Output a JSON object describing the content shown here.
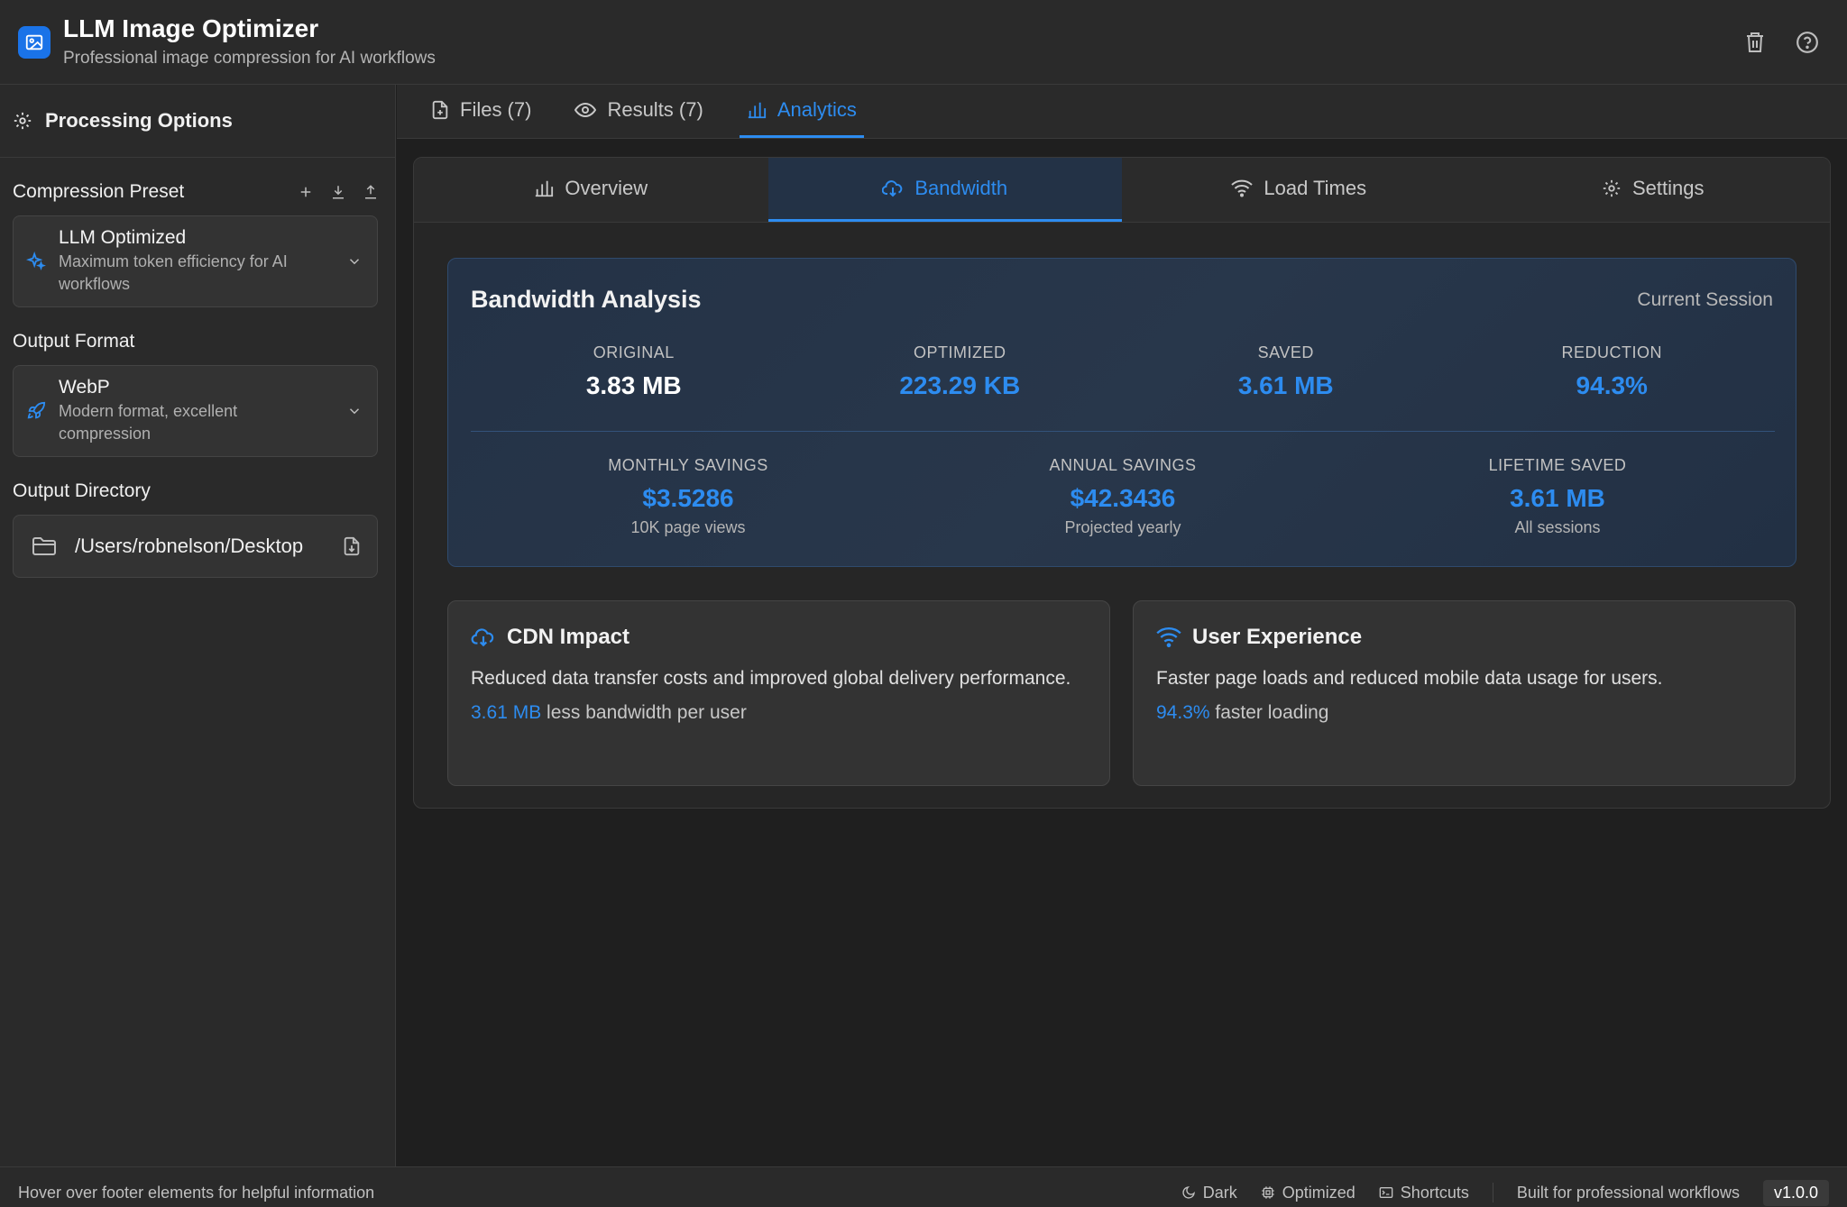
{
  "app": {
    "title": "LLM Image Optimizer",
    "subtitle": "Professional image compression for AI workflows",
    "logo_icon": "image-icon",
    "accent_color": "#2d8cf0"
  },
  "header": {
    "actions": [
      {
        "icon": "trash-icon"
      },
      {
        "icon": "help-circle-icon"
      }
    ]
  },
  "sidebar": {
    "title": "Processing Options",
    "compression_preset": {
      "label": "Compression Preset",
      "selected_title": "LLM Optimized",
      "selected_desc": "Maximum token efficiency for AI workflows",
      "actions": [
        "plus-icon",
        "download-icon",
        "upload-icon"
      ]
    },
    "output_format": {
      "label": "Output Format",
      "selected_title": "WebP",
      "selected_desc": "Modern format, excellent compression"
    },
    "output_directory": {
      "label": "Output Directory",
      "path": "/Users/robnelson/Desktop"
    }
  },
  "tabs": [
    {
      "label": "Files (7)",
      "icon": "file-icon",
      "active": false
    },
    {
      "label": "Results (7)",
      "icon": "eye-icon",
      "active": false
    },
    {
      "label": "Analytics",
      "icon": "bar-chart-icon",
      "active": true
    }
  ],
  "sub_tabs": [
    {
      "label": "Overview",
      "icon": "bar-chart-icon",
      "active": false
    },
    {
      "label": "Bandwidth",
      "icon": "cloud-download-icon",
      "active": true
    },
    {
      "label": "Load Times",
      "icon": "wifi-icon",
      "active": false
    },
    {
      "label": "Settings",
      "icon": "gear-icon",
      "active": false
    }
  ],
  "bandwidth": {
    "title": "Bandwidth Analysis",
    "session": "Current Session",
    "original_label": "ORIGINAL",
    "original_value": "3.83 MB",
    "optimized_label": "OPTIMIZED",
    "optimized_value": "223.29 KB",
    "saved_label": "SAVED",
    "saved_value": "3.61 MB",
    "reduction_label": "REDUCTION",
    "reduction_value": "94.3%",
    "monthly_label": "MONTHLY SAVINGS",
    "monthly_value": "$3.5286",
    "monthly_sub": "10K page views",
    "annual_label": "ANNUAL SAVINGS",
    "annual_value": "$42.3436",
    "annual_sub": "Projected yearly",
    "lifetime_label": "LIFETIME SAVED",
    "lifetime_value": "3.61 MB",
    "lifetime_sub": "All sessions"
  },
  "cdn": {
    "title": "CDN Impact",
    "desc": "Reduced data transfer costs and improved global delivery performance.",
    "metric_value": "3.61 MB",
    "metric_text": " less bandwidth per user"
  },
  "ux": {
    "title": "User Experience",
    "desc": "Faster page loads and reduced mobile data usage for users.",
    "metric_value": "94.3%",
    "metric_text": " faster loading"
  },
  "footer": {
    "hint": "Hover over footer elements for helpful information",
    "dark": "Dark",
    "optimized": "Optimized",
    "shortcuts": "Shortcuts",
    "built_for": "Built for professional workflows",
    "version": "v1.0.0"
  }
}
